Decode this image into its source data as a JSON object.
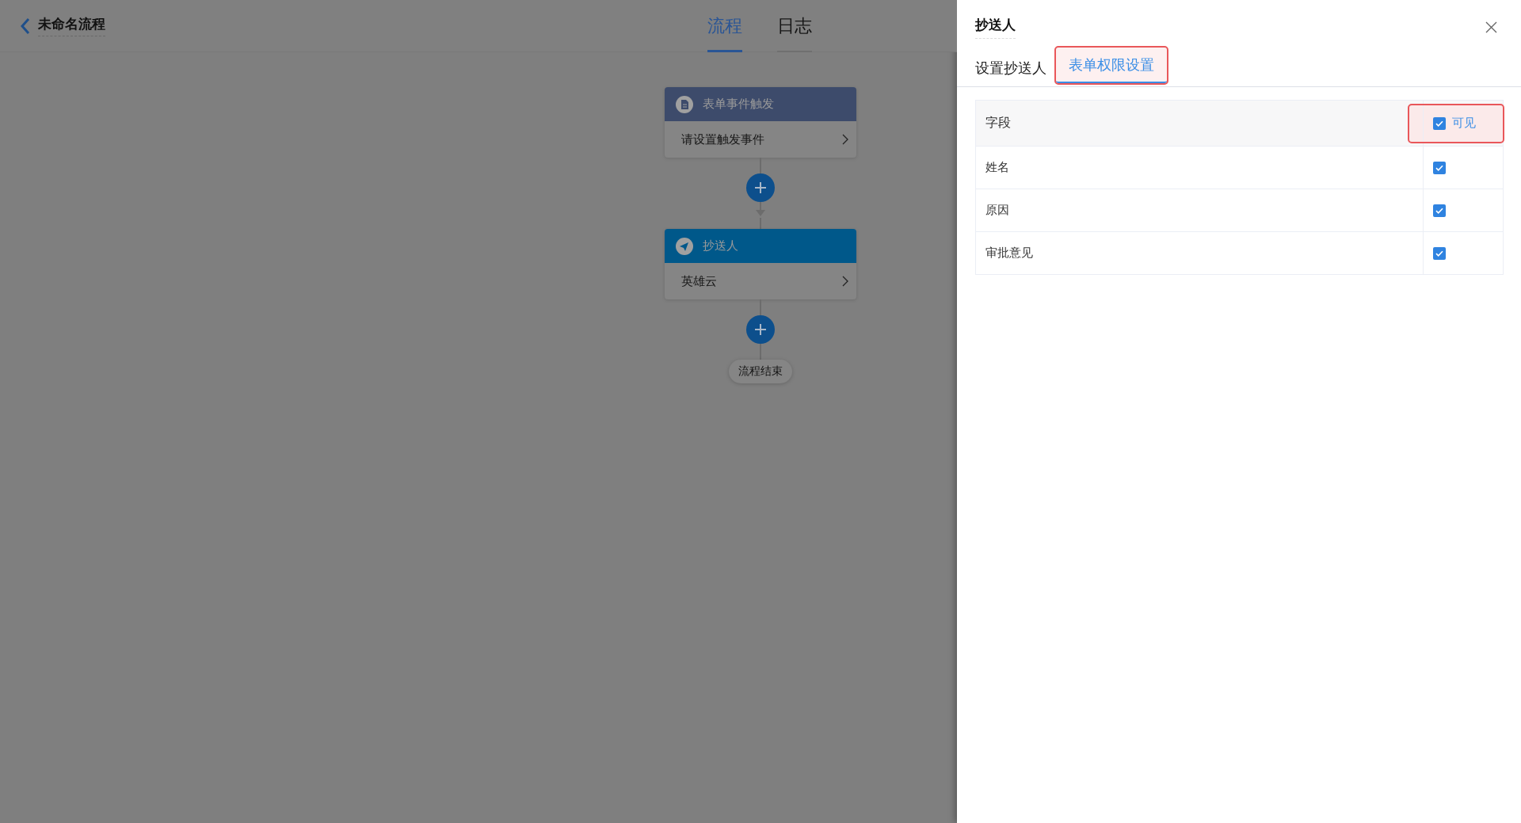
{
  "header": {
    "title": "未命名流程"
  },
  "view_tabs": [
    {
      "label": "流程",
      "selected": true
    },
    {
      "label": "日志",
      "selected": false
    }
  ],
  "flow": {
    "nodes": [
      {
        "kind": "trigger",
        "title": "表单事件触发",
        "content": "请设置触发事件"
      },
      {
        "kind": "cc",
        "title": "抄送人",
        "content": "英雄云"
      }
    ],
    "end": "流程结束"
  },
  "drawer": {
    "title": "抄送人",
    "tabs": [
      {
        "label": "设置抄送人",
        "selected": false,
        "highlighted": false
      },
      {
        "label": "表单权限设置",
        "selected": true,
        "highlighted": true
      }
    ],
    "table": {
      "columns": [
        {
          "label": "字段"
        },
        {
          "label": "可见",
          "checked": true,
          "highlighted": true
        }
      ],
      "rows": [
        {
          "field": "姓名",
          "visible": true
        },
        {
          "field": "原因",
          "visible": true
        },
        {
          "field": "审批意见",
          "visible": true
        }
      ]
    }
  }
}
